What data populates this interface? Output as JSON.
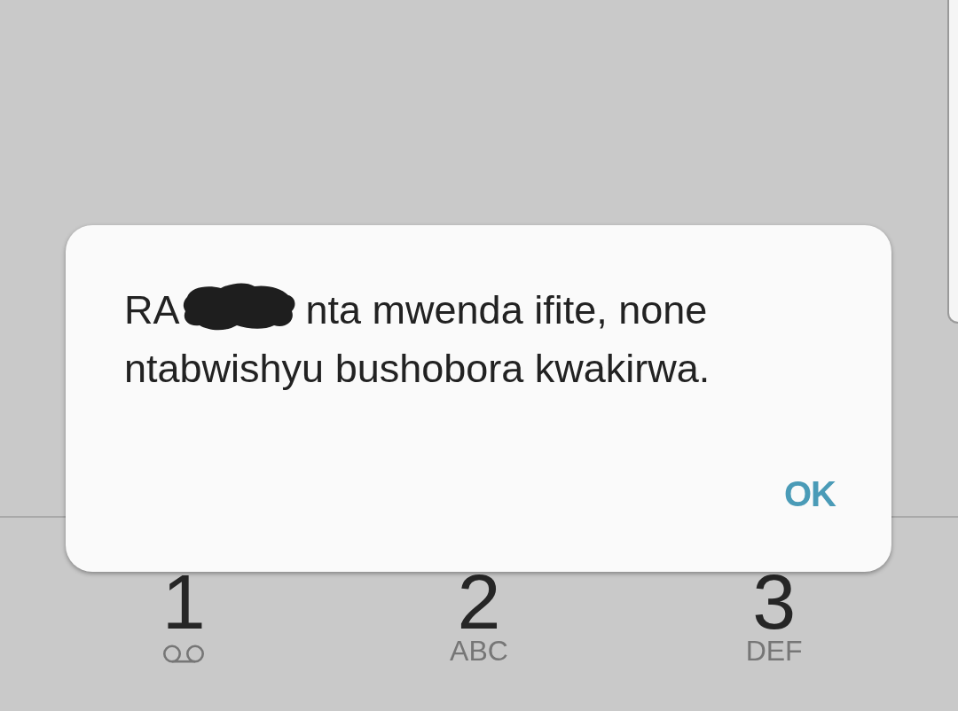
{
  "dialog": {
    "message": {
      "before_redaction": "RA",
      "redacted": true,
      "after_redaction_lines": [
        "nta mwenda ifite, none",
        "ntabwishyu bushobora kwakirwa."
      ]
    },
    "buttons": [
      {
        "label": "OK"
      }
    ]
  },
  "dialpad": {
    "keys": [
      {
        "digit": "1",
        "kind": "voicemail"
      },
      {
        "digit": "2",
        "kind": "letters",
        "letters": "ABC"
      },
      {
        "digit": "3",
        "kind": "letters",
        "letters": "DEF"
      }
    ]
  }
}
